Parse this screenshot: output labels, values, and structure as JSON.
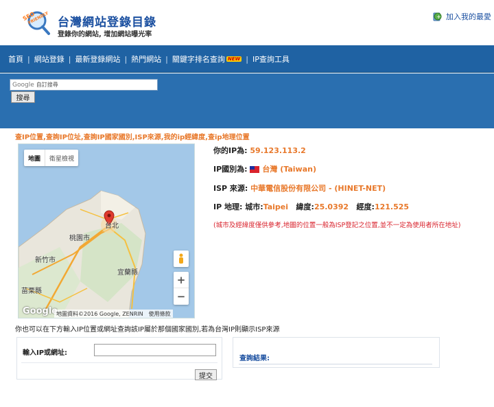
{
  "header": {
    "logo_badge_text": "SEO FRIENDLY",
    "title": "台灣網站登錄目錄",
    "subtitle": "登錄你的網站, 增加網站曝光率",
    "favorite_label": "加入我的最愛"
  },
  "nav": {
    "items": [
      {
        "label": "首頁"
      },
      {
        "label": "網站登錄"
      },
      {
        "label": "最新登錄網站"
      },
      {
        "label": "熱門網站"
      },
      {
        "label": "關鍵字排名查詢",
        "badge": "NEW"
      },
      {
        "label": "IP查詢工具"
      }
    ]
  },
  "search": {
    "google_label": "Google",
    "placeholder": "自訂搜尋",
    "button": "搜尋"
  },
  "intro": "查IP位置,查詢IP位址,查詢IP國家國別,ISP來源,我的ip經緯度,查ip地理位置",
  "map": {
    "type_map": "地圖",
    "type_satellite": "衛星檢視",
    "google_logo": "Google",
    "attribution": "地圖資料©2016 Google, ZENRIN",
    "terms": "使用條款",
    "cities": {
      "taipei": "台北",
      "taoyuan": "桃園市",
      "hsinchu": "新竹市",
      "yilan": "宜蘭縣",
      "miaoli": "苗栗縣"
    },
    "zoom_in": "+",
    "zoom_out": "−"
  },
  "info": {
    "ip_label": "你的IP為:",
    "ip_value": "59.123.113.2",
    "country_label": "IP國別為:",
    "country_value": "台灣 (Taiwan)",
    "isp_label": "ISP 來源:",
    "isp_value": "中華電信股份有限公司 - (HINET-NET)",
    "geo_label": "IP 地理:",
    "city_label": "城市:",
    "city_value": "Taipei",
    "lat_label": "緯度:",
    "lat_value": "25.0392",
    "lng_label": "經度:",
    "lng_value": "121.525",
    "note": "(城市及經緯度僅供參考,地圖的位置一般為ISP登記之位置,並不一定為使用者所在地址)"
  },
  "helptext": "你也可以在下方輸入IP位置或網址查詢該IP屬於那個國家國別,若為台灣IP則顯示ISP來源",
  "form": {
    "input_label": "輸入IP或網址:",
    "input_value": "",
    "submit": "提交",
    "result_label": "查詢結果:"
  },
  "colors": {
    "nav_bg": "#1f62a3",
    "accent_orange": "#e8782a",
    "note_red": "#d9232d",
    "title_blue": "#1a4fa0"
  }
}
